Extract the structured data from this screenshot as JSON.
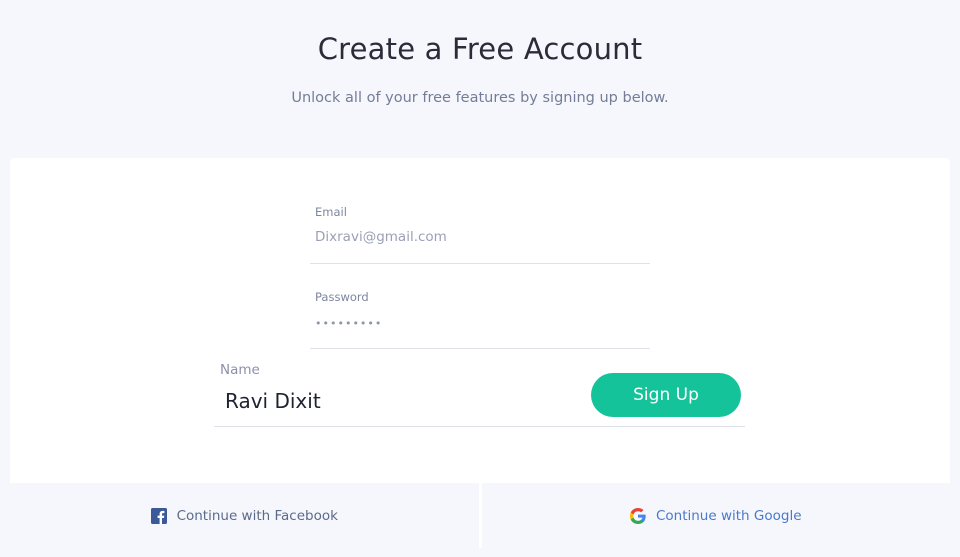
{
  "header": {
    "title": "Create a Free Account",
    "subtitle": "Unlock all of your free features by signing up below."
  },
  "form": {
    "email": {
      "label": "Email",
      "value": "Dixravi@gmail.com"
    },
    "password": {
      "label": "Password",
      "value": "•••••••••"
    },
    "name": {
      "label": "Name",
      "value": "Ravi Dixit"
    },
    "submit_label": "Sign Up"
  },
  "social": {
    "facebook_label": "Continue with Facebook",
    "google_label": "Continue with Google",
    "facebook_icon": "facebook-icon",
    "google_icon": "google-icon"
  },
  "colors": {
    "accent": "#15c39a",
    "facebook": "#3b5998",
    "google": "#4285f4"
  }
}
